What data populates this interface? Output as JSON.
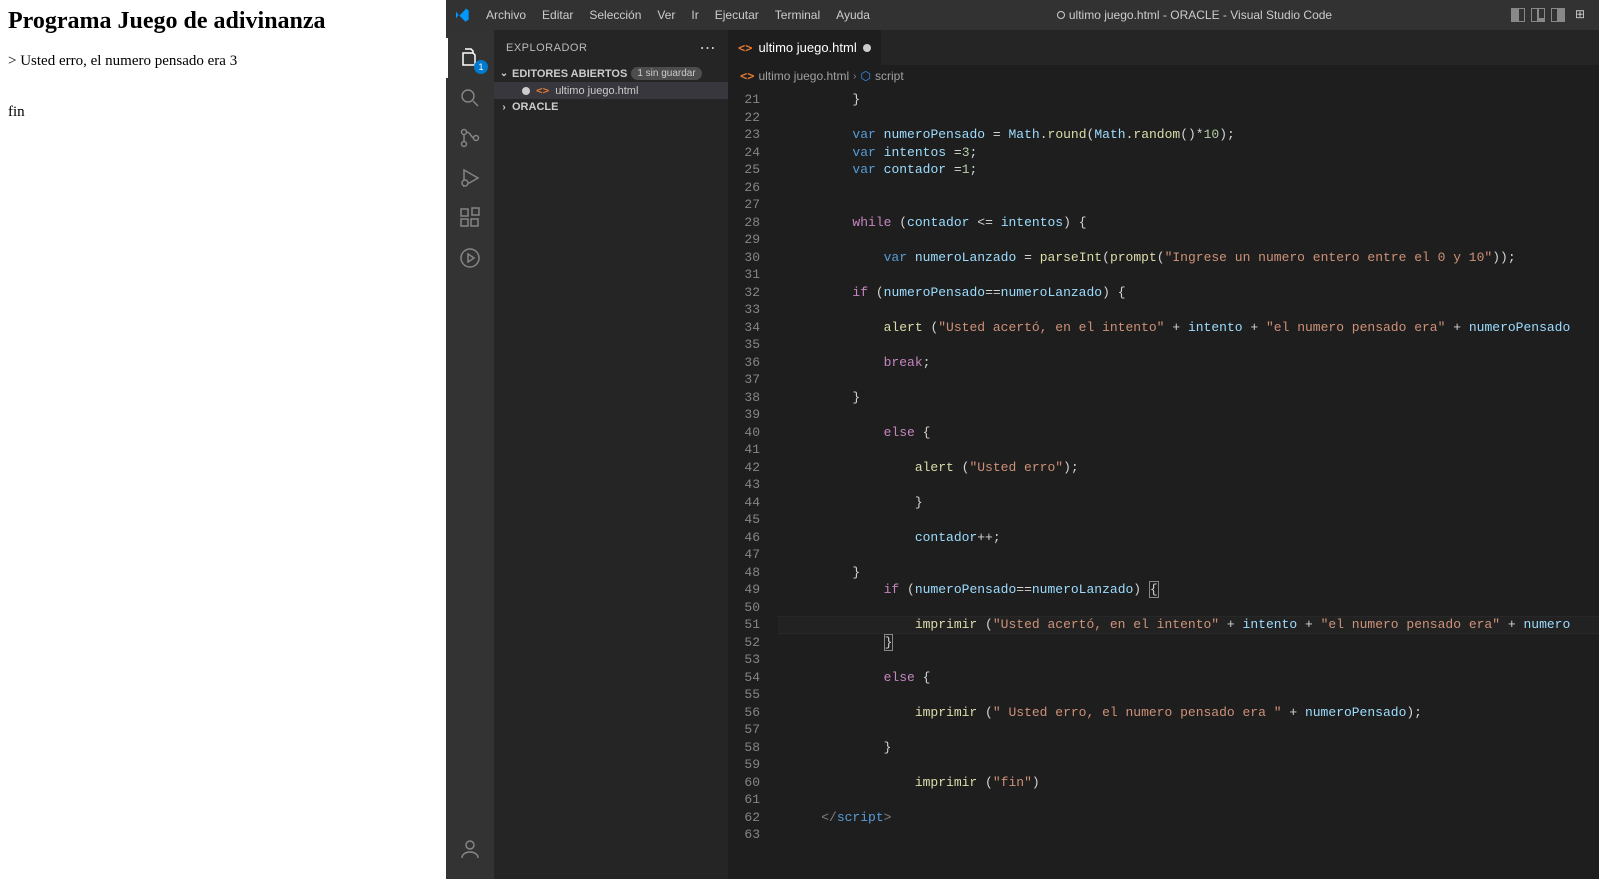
{
  "browser": {
    "title": "Programa Juego de adivinanza",
    "line1": "> Usted erro, el numero pensado era 3",
    "line2": "fin"
  },
  "vscode": {
    "menu": [
      "Archivo",
      "Editar",
      "Selección",
      "Ver",
      "Ir",
      "Ejecutar",
      "Terminal",
      "Ayuda"
    ],
    "windowTitle": "ultimo juego.html - ORACLE - Visual Studio Code",
    "activityBadge": "1",
    "sidebar": {
      "title": "EXPLORADOR",
      "openEditors": "EDITORES ABIERTOS",
      "unsavedBadge": "1 sin guardar",
      "file": "ultimo juego.html",
      "folder": "ORACLE"
    },
    "tab": "ultimo juego.html",
    "breadcrumb": {
      "file": "ultimo juego.html",
      "sym": "script"
    },
    "code": {
      "startLine": 21,
      "currentLine": 51,
      "lines": [
        {
          "n": 21,
          "html": "        <span class='tok-op'>}</span>"
        },
        {
          "n": 22,
          "html": ""
        },
        {
          "n": 23,
          "html": "        <span class='tok-kw'>var</span> <span class='tok-var'>numeroPensado</span> <span class='tok-op'>=</span> <span class='tok-var'>Math</span>.<span class='tok-fn'>round</span>(<span class='tok-var'>Math</span>.<span class='tok-fn'>random</span>()*<span class='tok-num'>10</span>);"
        },
        {
          "n": 24,
          "html": "        <span class='tok-kw'>var</span> <span class='tok-var'>intentos</span> <span class='tok-op'>=</span><span class='tok-num'>3</span>;"
        },
        {
          "n": 25,
          "html": "        <span class='tok-kw'>var</span> <span class='tok-var'>contador</span> <span class='tok-op'>=</span><span class='tok-num'>1</span>;"
        },
        {
          "n": 26,
          "html": ""
        },
        {
          "n": 27,
          "html": ""
        },
        {
          "n": 28,
          "html": "        <span class='tok-ctrl'>while</span> (<span class='tok-var'>contador</span> <span class='tok-op'>&lt;=</span> <span class='tok-var'>intentos</span>) {"
        },
        {
          "n": 29,
          "html": ""
        },
        {
          "n": 30,
          "html": "            <span class='tok-kw'>var</span> <span class='tok-var'>numeroLanzado</span> <span class='tok-op'>=</span> <span class='tok-fn'>parseInt</span>(<span class='tok-fn'>prompt</span>(<span class='tok-str'>\"Ingrese un numero entero entre el 0 y 10\"</span>));"
        },
        {
          "n": 31,
          "html": ""
        },
        {
          "n": 32,
          "html": "        <span class='tok-ctrl'>if</span> (<span class='tok-var'>numeroPensado</span><span class='tok-op'>==</span><span class='tok-var'>numeroLanzado</span>) {"
        },
        {
          "n": 33,
          "html": ""
        },
        {
          "n": 34,
          "html": "            <span class='tok-fn'>alert</span> (<span class='tok-str'>\"Usted acertó, en el intento\"</span> <span class='tok-op'>+</span> <span class='tok-var'>intento</span> <span class='tok-op'>+</span> <span class='tok-str'>\"el numero pensado era\"</span> <span class='tok-op'>+</span> <span class='tok-var'>numeroPensado</span>"
        },
        {
          "n": 35,
          "html": ""
        },
        {
          "n": 36,
          "html": "            <span class='tok-ctrl'>break</span>;"
        },
        {
          "n": 37,
          "html": ""
        },
        {
          "n": 38,
          "html": "        }"
        },
        {
          "n": 39,
          "html": ""
        },
        {
          "n": 40,
          "html": "            <span class='tok-ctrl'>else</span> {"
        },
        {
          "n": 41,
          "html": ""
        },
        {
          "n": 42,
          "html": "                <span class='tok-fn'>alert</span> (<span class='tok-str'>\"Usted erro\"</span>);"
        },
        {
          "n": 43,
          "html": ""
        },
        {
          "n": 44,
          "html": "                }"
        },
        {
          "n": 45,
          "html": ""
        },
        {
          "n": 46,
          "html": "                <span class='tok-var'>contador</span><span class='tok-op'>++</span>;"
        },
        {
          "n": 47,
          "html": ""
        },
        {
          "n": 48,
          "html": "        }"
        },
        {
          "n": 49,
          "html": "            <span class='tok-ctrl'>if</span> (<span class='tok-var'>numeroPensado</span><span class='tok-op'>==</span><span class='tok-var'>numeroLanzado</span>) <span class='bracket-box'>{</span>"
        },
        {
          "n": 50,
          "html": ""
        },
        {
          "n": 51,
          "html": "                <span class='tok-fn'>imprimir</span> (<span class='tok-str'>\"Usted acertó, en el intento\"</span> <span class='tok-op'>+</span> <span class='tok-var'>intento</span> <span class='tok-op'>+</span> <span class='tok-str'>\"el numero pensado era\"</span> <span class='tok-op'>+</span> <span class='tok-var'>numero</span>"
        },
        {
          "n": 52,
          "html": "            <span class='bracket-box'>}</span>"
        },
        {
          "n": 53,
          "html": ""
        },
        {
          "n": 54,
          "html": "            <span class='tok-ctrl'>else</span> {"
        },
        {
          "n": 55,
          "html": ""
        },
        {
          "n": 56,
          "html": "                <span class='tok-fn'>imprimir</span> (<span class='tok-str'>\" Usted erro, el numero pensado era \"</span> <span class='tok-op'>+</span> <span class='tok-var'>numeroPensado</span>);"
        },
        {
          "n": 57,
          "html": ""
        },
        {
          "n": 58,
          "html": "            }"
        },
        {
          "n": 59,
          "html": ""
        },
        {
          "n": 60,
          "html": "                <span class='tok-fn'>imprimir</span> (<span class='tok-str'>\"fin\"</span>)"
        },
        {
          "n": 61,
          "html": ""
        },
        {
          "n": 62,
          "html": "    <span class='tok-tag'>&lt;/</span><span class='tok-tagname'>script</span><span class='tok-tag'>&gt;</span>"
        },
        {
          "n": 63,
          "html": ""
        }
      ]
    }
  }
}
